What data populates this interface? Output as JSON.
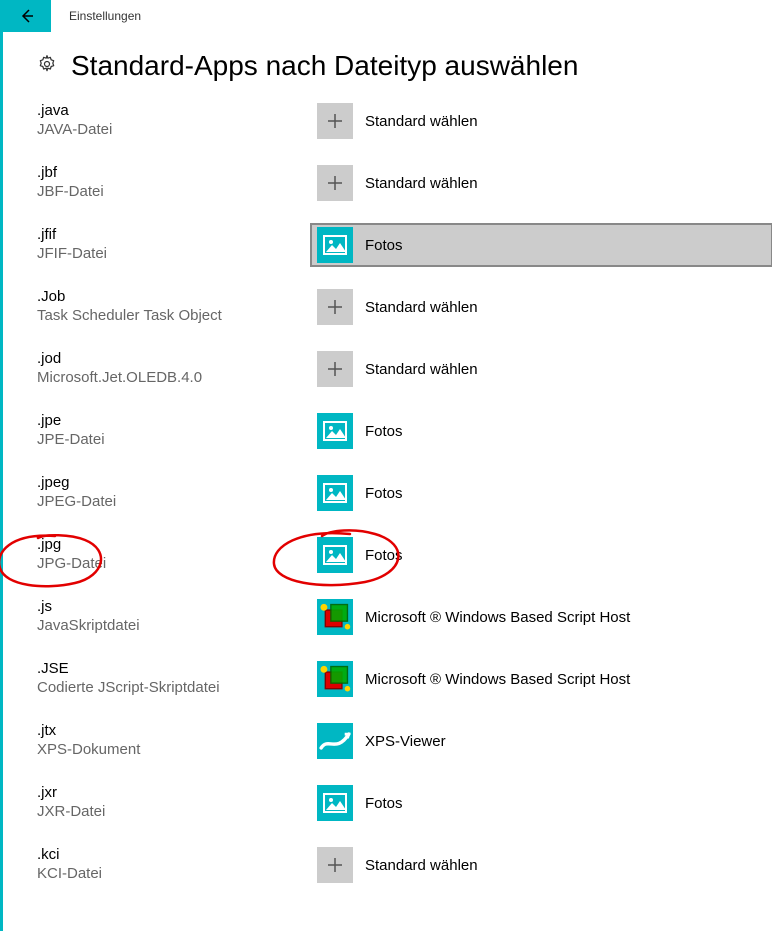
{
  "window": {
    "title": "Einstellungen"
  },
  "page": {
    "heading": "Standard-Apps nach Dateityp auswählen"
  },
  "labels": {
    "choose_default": "Standard wählen",
    "photos": "Fotos",
    "script_host": "Microsoft ® Windows Based Script Host",
    "xps_viewer": "XPS-Viewer"
  },
  "rows": [
    {
      "ext": ".java",
      "desc": "JAVA-Datei",
      "app": "choose_default",
      "icon": "plus"
    },
    {
      "ext": ".jbf",
      "desc": "JBF-Datei",
      "app": "choose_default",
      "icon": "plus"
    },
    {
      "ext": ".jfif",
      "desc": "JFIF-Datei",
      "app": "photos",
      "icon": "photos",
      "selected": true
    },
    {
      "ext": ".Job",
      "desc": "Task Scheduler Task Object",
      "app": "choose_default",
      "icon": "plus"
    },
    {
      "ext": ".jod",
      "desc": "Microsoft.Jet.OLEDB.4.0",
      "app": "choose_default",
      "icon": "plus"
    },
    {
      "ext": ".jpe",
      "desc": "JPE-Datei",
      "app": "photos",
      "icon": "photos"
    },
    {
      "ext": ".jpeg",
      "desc": "JPEG-Datei",
      "app": "photos",
      "icon": "photos"
    },
    {
      "ext": ".jpg",
      "desc": "JPG-Datei",
      "app": "photos",
      "icon": "photos"
    },
    {
      "ext": ".js",
      "desc": "JavaSkriptdatei",
      "app": "script_host",
      "icon": "script"
    },
    {
      "ext": ".JSE",
      "desc": "Codierte JScript-Skriptdatei",
      "app": "script_host",
      "icon": "script"
    },
    {
      "ext": ".jtx",
      "desc": "XPS-Dokument",
      "app": "xps_viewer",
      "icon": "xps"
    },
    {
      "ext": ".jxr",
      "desc": "JXR-Datei",
      "app": "photos",
      "icon": "photos"
    },
    {
      "ext": ".kci",
      "desc": "KCI-Datei",
      "app": "choose_default",
      "icon": "plus"
    }
  ]
}
